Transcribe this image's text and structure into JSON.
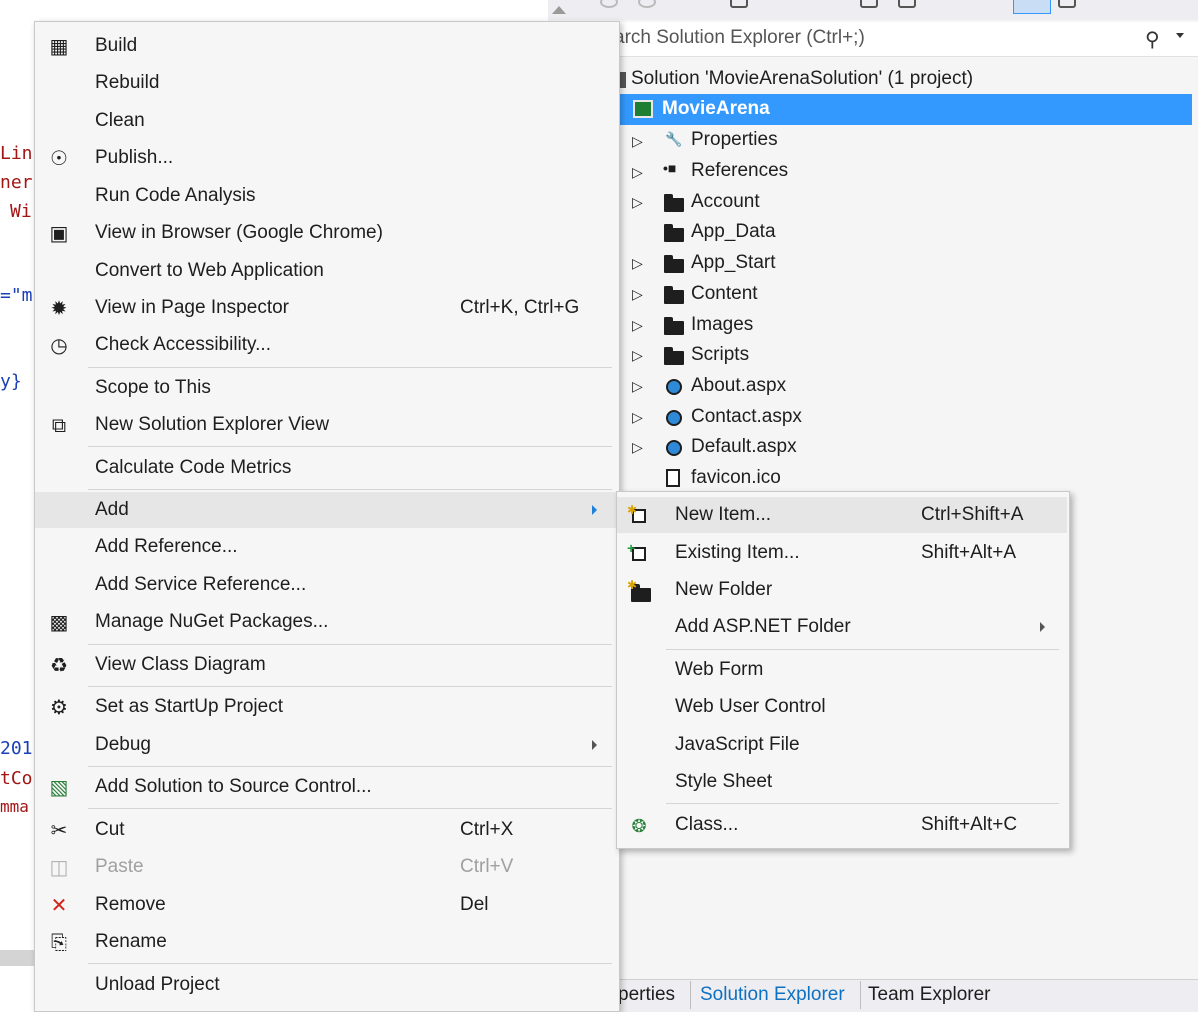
{
  "editor": {
    "fragments": [
      "Lin",
      "ner",
      "Wi",
      "=\"m",
      "y}",
      "201",
      "tCo",
      "mma"
    ]
  },
  "solution_explorer": {
    "search_placeholder": "arch Solution Explorer (Ctrl+;)",
    "solution_label": "Solution 'MovieArenaSolution' (1 project)",
    "project_label": "MovieArena",
    "items": [
      {
        "label": "Properties",
        "icon": "wrench-icon",
        "expandable": true
      },
      {
        "label": "References",
        "icon": "references-icon",
        "expandable": true
      },
      {
        "label": "Account",
        "icon": "folder-icon",
        "expandable": true
      },
      {
        "label": "App_Data",
        "icon": "folder-icon",
        "expandable": false
      },
      {
        "label": "App_Start",
        "icon": "folder-icon",
        "expandable": true
      },
      {
        "label": "Content",
        "icon": "folder-icon",
        "expandable": true
      },
      {
        "label": "Images",
        "icon": "folder-icon",
        "expandable": true
      },
      {
        "label": "Scripts",
        "icon": "folder-icon",
        "expandable": true
      },
      {
        "label": "About.aspx",
        "icon": "aspx-file-icon",
        "expandable": true
      },
      {
        "label": "Contact.aspx",
        "icon": "aspx-file-icon",
        "expandable": true
      },
      {
        "label": "Default.aspx",
        "icon": "aspx-file-icon",
        "expandable": true
      },
      {
        "label": "favicon.ico",
        "icon": "file-icon",
        "expandable": false
      }
    ],
    "tabs": [
      "perties",
      "Solution Explorer",
      "Team Explorer"
    ],
    "selection_color": "#3399ff"
  },
  "context_menu": {
    "items": [
      {
        "label": "Build",
        "icon": "build-icon",
        "shortcut": ""
      },
      {
        "label": "Rebuild",
        "icon": "",
        "shortcut": ""
      },
      {
        "label": "Clean",
        "icon": "",
        "shortcut": ""
      },
      {
        "label": "Publish...",
        "icon": "publish-globe-icon",
        "shortcut": ""
      },
      {
        "label": "Run Code Analysis",
        "icon": "",
        "shortcut": ""
      },
      {
        "label": "View in Browser (Google Chrome)",
        "icon": "browser-icon",
        "shortcut": ""
      },
      {
        "label": "Convert to Web Application",
        "icon": "",
        "shortcut": ""
      },
      {
        "label": "View in Page Inspector",
        "icon": "page-inspector-icon",
        "shortcut": "Ctrl+K, Ctrl+G"
      },
      {
        "label": "Check Accessibility...",
        "icon": "accessibility-icon",
        "shortcut": ""
      },
      {
        "label": "Scope to This",
        "icon": "",
        "shortcut": ""
      },
      {
        "label": "New Solution Explorer View",
        "icon": "new-view-icon",
        "shortcut": ""
      },
      {
        "label": "Calculate Code Metrics",
        "icon": "",
        "shortcut": ""
      },
      {
        "label": "Add",
        "icon": "",
        "shortcut": "",
        "submenu": true
      },
      {
        "label": "Add Reference...",
        "icon": "",
        "shortcut": ""
      },
      {
        "label": "Add Service Reference...",
        "icon": "",
        "shortcut": ""
      },
      {
        "label": "Manage NuGet Packages...",
        "icon": "nuget-icon",
        "shortcut": ""
      },
      {
        "label": "View Class Diagram",
        "icon": "class-diagram-icon",
        "shortcut": ""
      },
      {
        "label": "Set as StartUp Project",
        "icon": "gear-icon",
        "shortcut": ""
      },
      {
        "label": "Debug",
        "icon": "",
        "shortcut": "",
        "submenu": true
      },
      {
        "label": "Add Solution to Source Control...",
        "icon": "source-control-icon",
        "shortcut": ""
      },
      {
        "label": "Cut",
        "icon": "scissors-icon",
        "shortcut": "Ctrl+X"
      },
      {
        "label": "Paste",
        "icon": "paste-icon",
        "shortcut": "Ctrl+V",
        "disabled": true
      },
      {
        "label": "Remove",
        "icon": "remove-x-icon",
        "shortcut": "Del"
      },
      {
        "label": "Rename",
        "icon": "rename-icon",
        "shortcut": ""
      },
      {
        "label": "Unload Project",
        "icon": "",
        "shortcut": ""
      }
    ]
  },
  "add_submenu": {
    "items": [
      {
        "label": "New Item...",
        "icon": "new-item-icon",
        "shortcut": "Ctrl+Shift+A"
      },
      {
        "label": "Existing Item...",
        "icon": "existing-item-icon",
        "shortcut": "Shift+Alt+A"
      },
      {
        "label": "New Folder",
        "icon": "new-folder-icon",
        "shortcut": ""
      },
      {
        "label": "Add ASP.NET Folder",
        "icon": "",
        "shortcut": "",
        "submenu": true
      },
      {
        "label": "Web Form",
        "icon": "",
        "shortcut": ""
      },
      {
        "label": "Web User Control",
        "icon": "",
        "shortcut": ""
      },
      {
        "label": "JavaScript File",
        "icon": "",
        "shortcut": ""
      },
      {
        "label": "Style Sheet",
        "icon": "",
        "shortcut": ""
      },
      {
        "label": "Class...",
        "icon": "class-icon",
        "shortcut": "Shift+Alt+C"
      }
    ]
  }
}
